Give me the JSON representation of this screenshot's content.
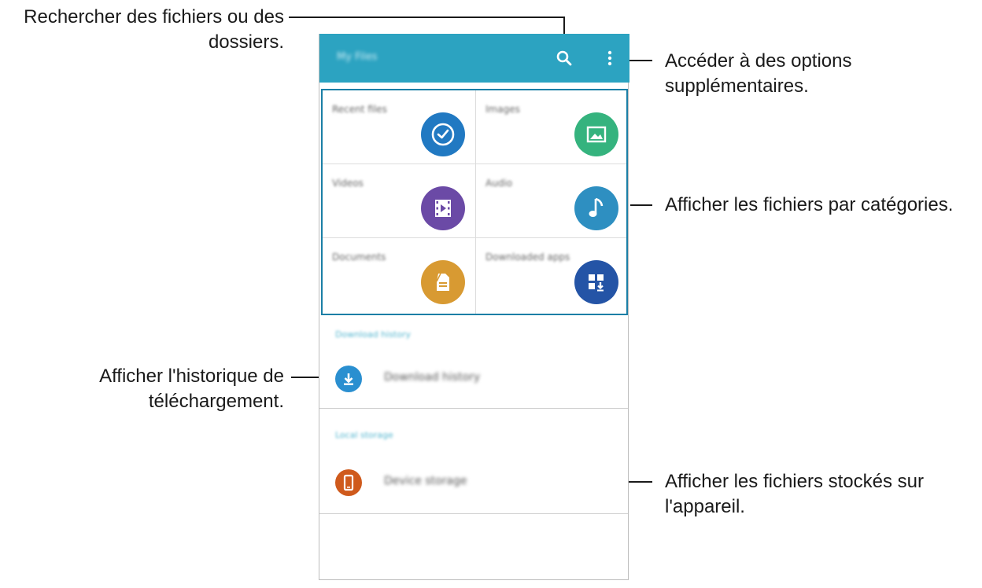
{
  "annotations": {
    "search": [
      "Rechercher des fichiers ou des",
      "dossiers."
    ],
    "options": [
      "Accéder à des options",
      "supplémentaires."
    ],
    "categories": "Afficher les fichiers par catégories.",
    "history": [
      "Afficher l'historique de",
      "téléchargement."
    ],
    "storage": [
      "Afficher les fichiers stockés sur",
      "l'appareil."
    ]
  },
  "app": {
    "title": "My Files",
    "categories": [
      {
        "label": "Recent files",
        "icon": "clock-icon",
        "color": "#2179c2"
      },
      {
        "label": "Images",
        "icon": "image-icon",
        "color": "#35b37e"
      },
      {
        "label": "Videos",
        "icon": "film-icon",
        "color": "#6b4aa6"
      },
      {
        "label": "Audio",
        "icon": "music-note-icon",
        "color": "#2e8fc1"
      },
      {
        "label": "Documents",
        "icon": "document-icon",
        "color": "#d89a32"
      },
      {
        "label": "Downloaded apps",
        "icon": "apps-download-icon",
        "color": "#2454a6"
      }
    ],
    "download_section": "Download history",
    "download_item": "Download history",
    "local_section": "Local storage",
    "local_item": "Device storage"
  },
  "colors": {
    "appbar": "#2ca3c1",
    "highlight": "#1b7fa6",
    "download_icon": "#2a8fd0",
    "storage_icon": "#cf5a1c"
  }
}
